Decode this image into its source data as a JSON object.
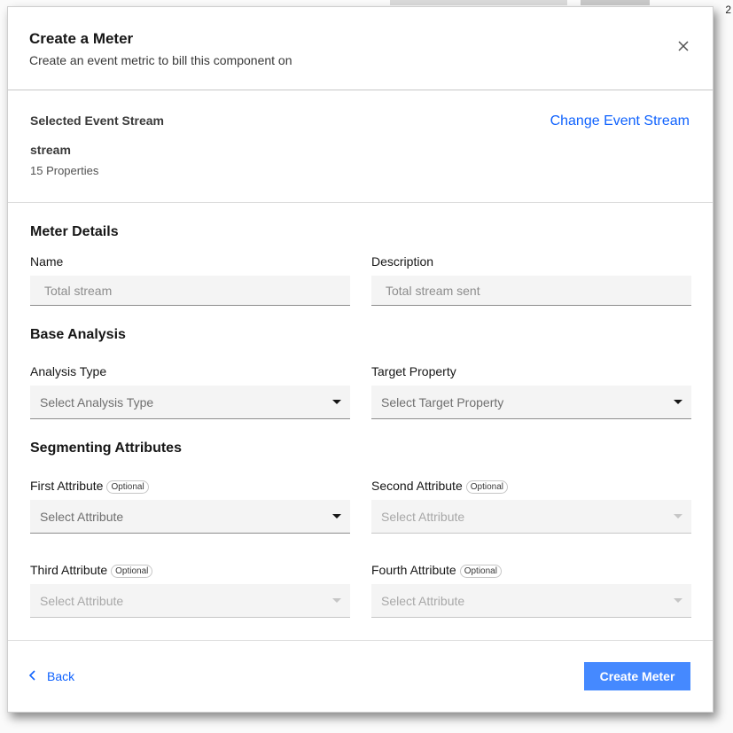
{
  "modal": {
    "title": "Create a Meter",
    "subtitle": "Create an event metric to bill this component on",
    "close_icon": "close-icon"
  },
  "event_stream": {
    "label": "Selected Event Stream",
    "change_link": "Change Event Stream",
    "name": "stream",
    "properties": "15 Properties"
  },
  "meter_details": {
    "heading": "Meter Details",
    "name_label": "Name",
    "name_placeholder": "Total stream",
    "description_label": "Description",
    "description_placeholder": "Total stream sent"
  },
  "base_analysis": {
    "heading": "Base Analysis",
    "analysis_type_label": "Analysis Type",
    "analysis_type_value": "Select Analysis Type",
    "target_property_label": "Target Property",
    "target_property_value": "Select Target Property"
  },
  "segmenting": {
    "heading": "Segmenting Attributes",
    "optional_tag": "Optional",
    "first_label": "First Attribute",
    "first_value": "Select Attribute",
    "second_label": "Second Attribute",
    "second_value": "Select Attribute",
    "third_label": "Third Attribute",
    "third_value": "Select Attribute",
    "fourth_label": "Fourth Attribute",
    "fourth_value": "Select Attribute"
  },
  "footer": {
    "back_label": "Back",
    "create_label": "Create Meter"
  },
  "background": {
    "corner_text": "2"
  },
  "colors": {
    "link": "#0f62fe",
    "primary_button": "#4589ff",
    "field_bg": "#f4f4f4"
  }
}
